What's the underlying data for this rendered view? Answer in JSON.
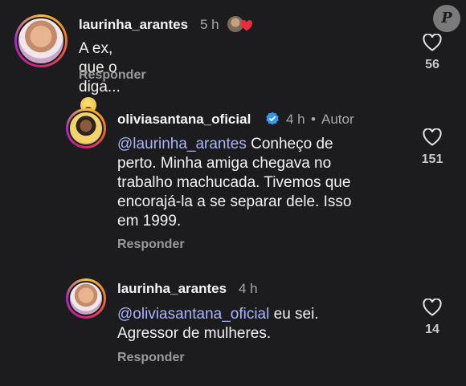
{
  "watermark": {
    "letter": "P"
  },
  "comments": [
    {
      "username": "laurinha_arantes",
      "time": "5 h",
      "text": "A ex, que o diga...",
      "reply_label": "Responder",
      "likes": "56",
      "icons": {
        "avatar": "avatar",
        "reaction": "heart-icon",
        "emoji": "face-emoji"
      }
    },
    {
      "username": "oliviasantana_oficial",
      "time": "4 h",
      "separator": "•",
      "author_tag": "Autor",
      "mention": "@laurinha_arantes",
      "text_lines": [
        " Conheço de",
        "perto. Minha amiga chegava no",
        "trabalho machucada. Tivemos que",
        "encorajá-la a se separar dele. Isso",
        "em 1999."
      ],
      "reply_label": "Responder",
      "likes": "151",
      "icons": {
        "verified": "verified-icon",
        "like": "heart-outline-icon"
      }
    },
    {
      "username": "laurinha_arantes",
      "time": "4 h",
      "mention": "@oliviasantana_oficial",
      "text_lines": [
        " eu sei.",
        "Agressor de mulheres."
      ],
      "reply_label": "Responder",
      "likes": "14"
    }
  ],
  "colors": {
    "background": "#1c1c1e",
    "mention": "#a9b4ff",
    "verified": "#3897f0",
    "secondary": "#a8a8a8"
  }
}
